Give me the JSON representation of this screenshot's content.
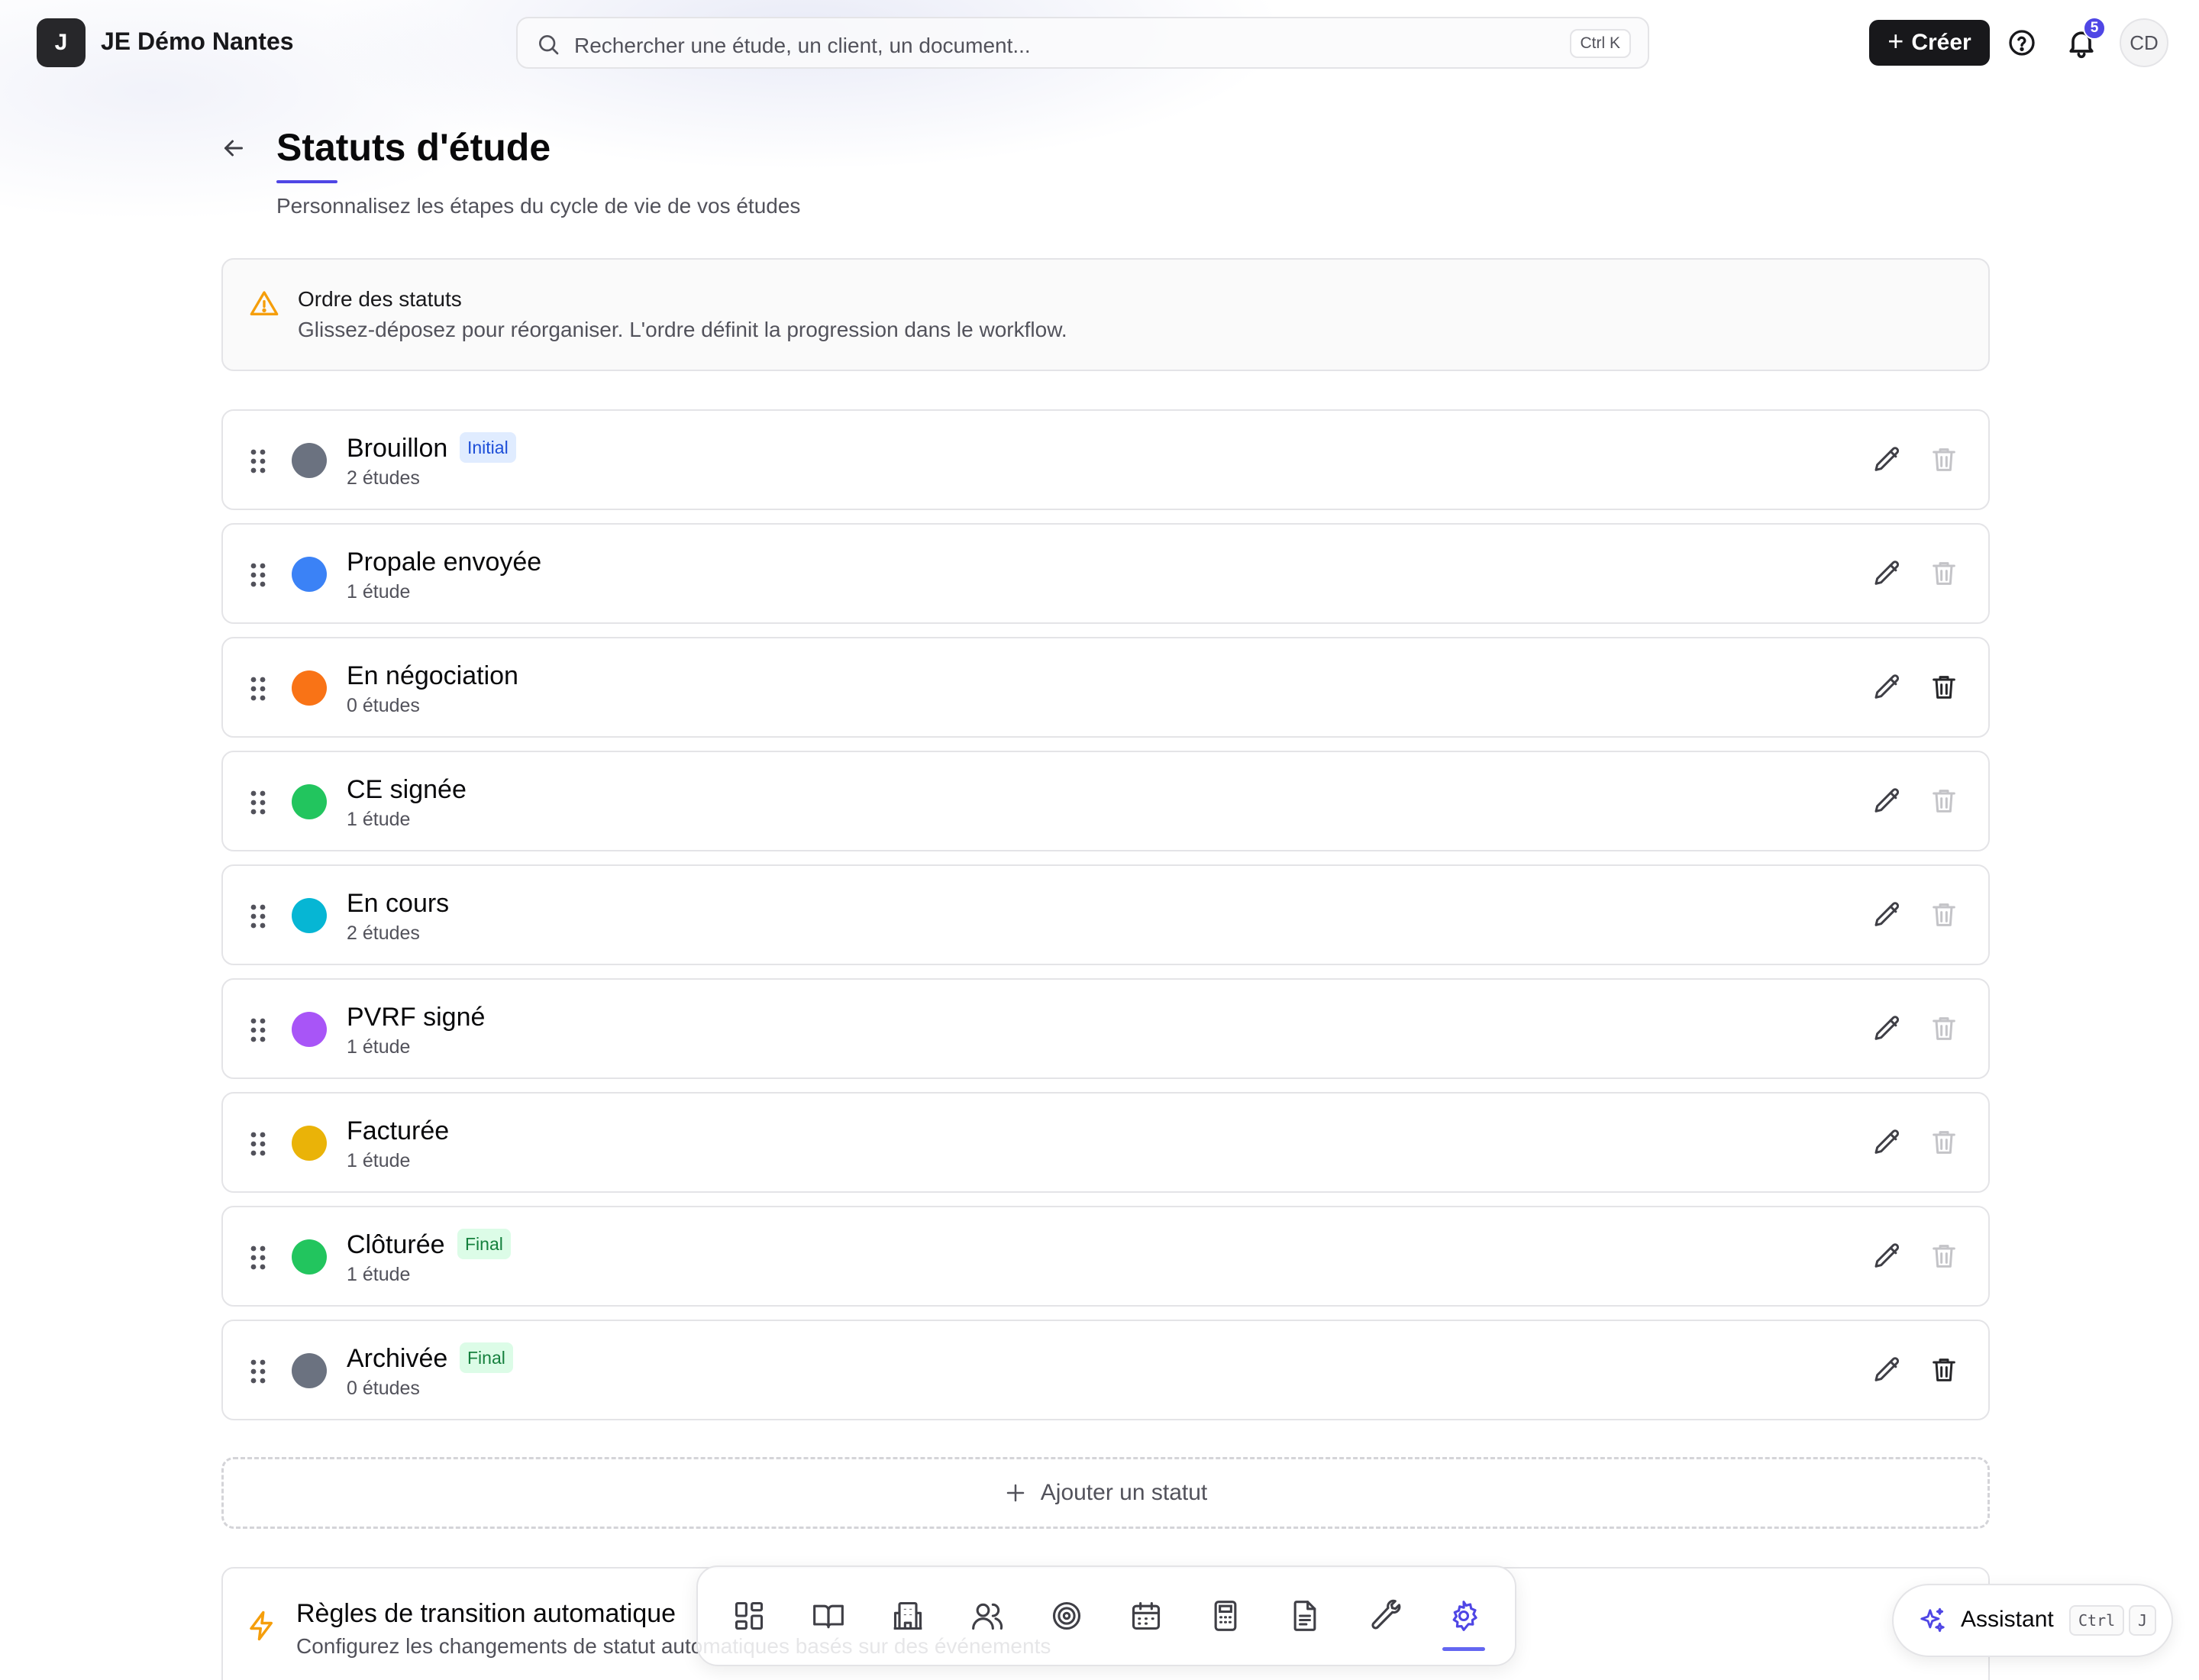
{
  "header": {
    "org_initial": "J",
    "org_name": "JE Démo Nantes",
    "search_placeholder": "Rechercher une étude, un client, un document...",
    "search_shortcut": "Ctrl K",
    "create_label": "Créer",
    "notification_count": "5",
    "user_initials": "CD"
  },
  "page": {
    "title": "Statuts d'étude",
    "subtitle": "Personnalisez les étapes du cycle de vie de vos études"
  },
  "info": {
    "title": "Ordre des statuts",
    "text": "Glissez-déposez pour réorganiser. L'ordre définit la progression dans le workflow."
  },
  "statuses": [
    {
      "name": "Brouillon",
      "count": "2 études",
      "color": "#6b7280",
      "badge": "Initial",
      "badge_type": "initial",
      "deletable": false
    },
    {
      "name": "Propale envoyée",
      "count": "1 étude",
      "color": "#3b82f6",
      "badge": "",
      "badge_type": "",
      "deletable": false
    },
    {
      "name": "En négociation",
      "count": "0 études",
      "color": "#f97316",
      "badge": "",
      "badge_type": "",
      "deletable": true
    },
    {
      "name": "CE signée",
      "count": "1 étude",
      "color": "#22c55e",
      "badge": "",
      "badge_type": "",
      "deletable": false
    },
    {
      "name": "En cours",
      "count": "2 études",
      "color": "#06b6d4",
      "badge": "",
      "badge_type": "",
      "deletable": false
    },
    {
      "name": "PVRF signé",
      "count": "1 étude",
      "color": "#a855f7",
      "badge": "",
      "badge_type": "",
      "deletable": false
    },
    {
      "name": "Facturée",
      "count": "1 étude",
      "color": "#eab308",
      "badge": "",
      "badge_type": "",
      "deletable": false
    },
    {
      "name": "Clôturée",
      "count": "1 étude",
      "color": "#22c55e",
      "badge": "Final",
      "badge_type": "final",
      "deletable": false
    },
    {
      "name": "Archivée",
      "count": "0 études",
      "color": "#6b7280",
      "badge": "Final",
      "badge_type": "final",
      "deletable": true
    }
  ],
  "add_status_label": "Ajouter un statut",
  "rules": {
    "title": "Règles de transition automatique",
    "text": "Configurez les changements de statut automatiques basés sur des événements"
  },
  "dock": {
    "items": [
      "dashboard-icon",
      "book-icon",
      "building-icon",
      "users-icon",
      "target-icon",
      "calendar-icon",
      "calculator-icon",
      "document-icon",
      "wrench-icon",
      "settings-icon"
    ],
    "active": "settings-icon"
  },
  "assistant": {
    "label": "Assistant",
    "shortcut_key1": "Ctrl",
    "shortcut_key2": "J"
  },
  "colors": {
    "accent": "#4f46e5",
    "primary_button": "#18181b"
  }
}
